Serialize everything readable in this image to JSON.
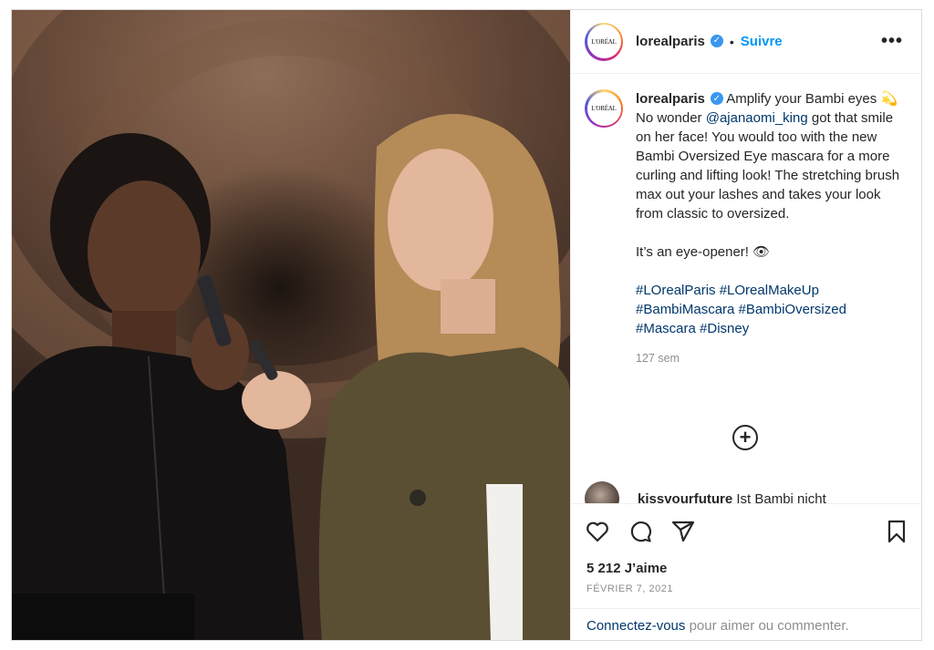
{
  "post": {
    "image_alt": "Two women, one holding a mascara wand",
    "account": {
      "handle": "lorealparis",
      "avatar_text": "L'ORÉAL",
      "verified_mark": "✓",
      "dot": "•",
      "follow_label": "Suivre",
      "more_label": "•••"
    },
    "caption": {
      "handle": "lorealparis",
      "line1": " Amplify your Bambi eyes 💫",
      "line2_prefix": "No wonder ",
      "mention": "@ajanaomi_king",
      "line2_suffix": " got that smile on her face! You would too with the new Bambi Oversized Eye mascara for a more curling and lifting look! The stretching brush max out your lashes and takes your look from classic to oversized.",
      "line3": "It’s an eye-opener! 👁",
      "hashtags": "#LOrealParis #LOrealMakeUp #BambiMascara #BambiOversized #Mascara #Disney",
      "time": "127 sem"
    },
    "load_more_symbol": "+",
    "comment": {
      "handle": "kissvourfuture",
      "text": " Ist Bambi nicht"
    },
    "actions": {
      "like_icon": "heart-icon",
      "comment_icon": "comment-icon",
      "share_icon": "paper-plane-icon",
      "save_icon": "bookmark-icon"
    },
    "likes": "5 212 J’aime",
    "date": "FÉVRIER 7, 2021",
    "login": {
      "link": "Connectez-vous",
      "rest": " pour aimer ou commenter."
    }
  },
  "colors": {
    "accent": "#0095f6",
    "link": "#00376b",
    "muted": "#8e8e8e",
    "text": "#262626"
  }
}
